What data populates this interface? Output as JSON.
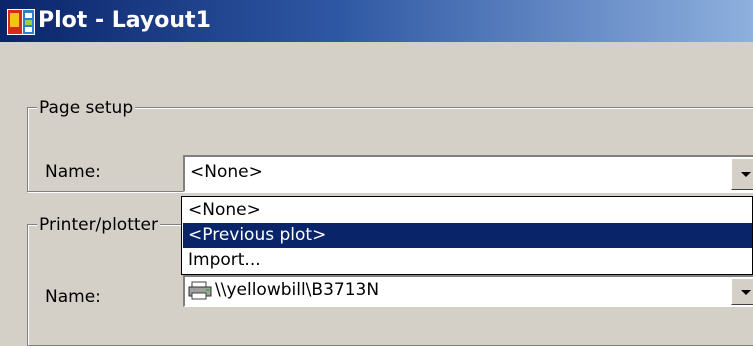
{
  "window": {
    "title": "Plot - Layout1",
    "titlebar_color": "#0a246a",
    "app_icon": "autocad-app-icon"
  },
  "page_setup": {
    "group_label": "Page setup",
    "name_label": "Name:",
    "selected_value": "<None>",
    "dropdown_open": true,
    "options": [
      {
        "label": "<None>",
        "highlighted": false
      },
      {
        "label": "<Previous plot>",
        "highlighted": true
      },
      {
        "label": "Import...",
        "highlighted": false
      }
    ]
  },
  "printer": {
    "group_label": "Printer/plotter",
    "name_label": "Name:",
    "selected_value": "\\\\yellowbill\\B3713N",
    "icon": "network-printer-icon"
  },
  "colors": {
    "dialog_bg": "#d4d0c8",
    "selection_bg": "#0a246a"
  }
}
